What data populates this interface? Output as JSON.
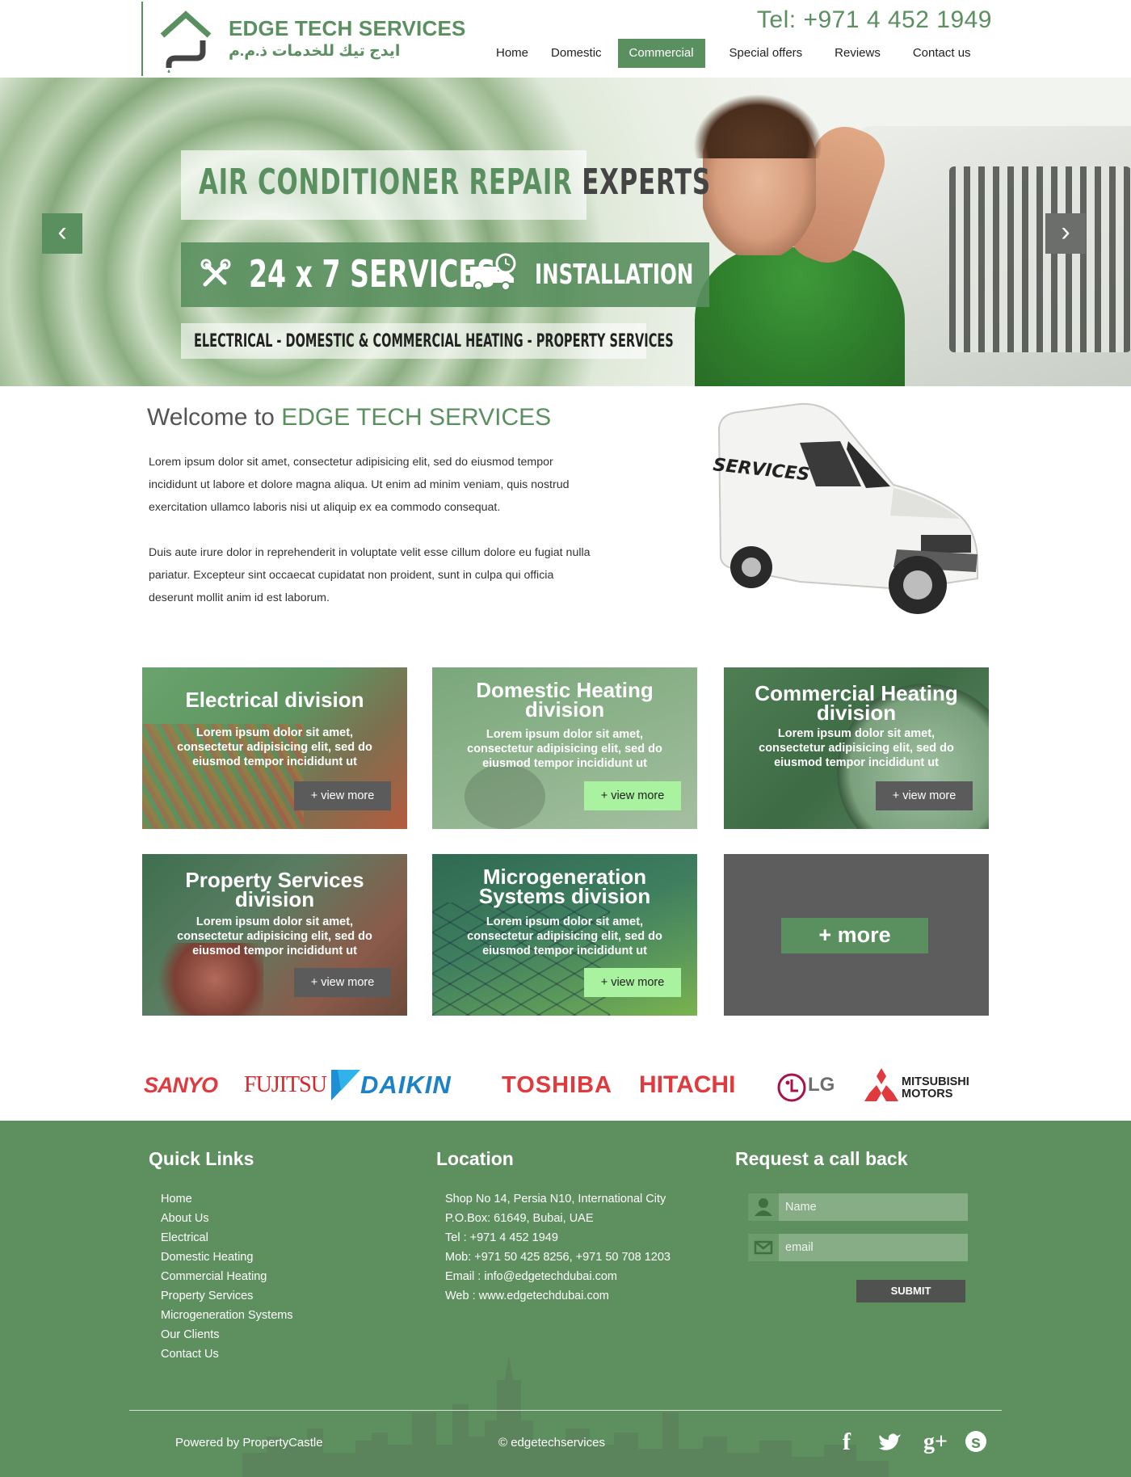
{
  "header": {
    "logo_title": "EDGE TECH SERVICES",
    "logo_arabic": "ايدج تيك للخدمات ذ.م.م",
    "phone": "Tel: +971 4 452 1949",
    "nav": [
      "Home",
      "Domestic",
      "Commercial",
      "Special offers",
      "Reviews",
      "Contact us"
    ],
    "nav_active": "Commercial"
  },
  "hero": {
    "title_green": "AIR  CONDITIONER REPAIR",
    "title_dark": "EXPERTS",
    "services": "24 x 7 SERVICES",
    "installation": "INSTALLATION",
    "subtitle": "ELECTRICAL - DOMESTIC & COMMERCIAL HEATING - PROPERTY SERVICES",
    "prev": "‹",
    "next": "›"
  },
  "welcome": {
    "title_prefix": "Welcome to",
    "title_brand": "EDGE TECH SERVICES",
    "p1_lines": [
      "Lorem ipsum dolor sit amet, consectetur adipisicing elit, sed do eiusmod tempor",
      "incididunt ut labore et dolore magna aliqua. Ut enim ad minim veniam, quis nostrud",
      "exercitation ullamco laboris nisi ut aliquip ex ea commodo consequat."
    ],
    "p2_lines": [
      "Duis aute irure dolor in reprehenderit in voluptate velit esse cillum dolore eu fugiat nulla",
      "pariatur. Excepteur sint occaecat cupidatat non proident, sunt in culpa qui officia",
      "deserunt mollit anim id est laborum."
    ],
    "van_label": "SERVICES"
  },
  "divisions": [
    {
      "title_lines": [
        "Electrical division"
      ],
      "desc_lines": [
        "Lorem ipsum dolor sit amet,",
        "consectetur adipisicing elit, sed do",
        "eiusmod tempor incididunt ut"
      ],
      "button": "+ view more"
    },
    {
      "title_lines": [
        "Domestic Heating",
        "division"
      ],
      "desc_lines": [
        "Lorem ipsum dolor sit amet,",
        "consectetur adipisicing elit, sed do",
        "eiusmod tempor incididunt ut"
      ],
      "button": "+ view more"
    },
    {
      "title_lines": [
        "Commercial Heating",
        "division"
      ],
      "desc_lines": [
        "Lorem ipsum dolor sit amet,",
        "consectetur adipisicing elit, sed do",
        "eiusmod tempor incididunt ut"
      ],
      "button": "+ view more"
    },
    {
      "title_lines": [
        "Property Services",
        "division"
      ],
      "desc_lines": [
        "Lorem ipsum dolor sit amet,",
        "consectetur adipisicing elit, sed do",
        "eiusmod tempor incididunt ut"
      ],
      "button": "+ view more"
    },
    {
      "title_lines": [
        "Microgeneration",
        "Systems division"
      ],
      "desc_lines": [
        "Lorem ipsum dolor sit amet,",
        "consectetur adipisicing elit, sed do",
        "eiusmod tempor incididunt ut"
      ],
      "button": "+ view more"
    }
  ],
  "more_button": "+ more",
  "brands": [
    "SANYO",
    "FUJITSU",
    "DAIKIN",
    "TOSHIBA",
    "HITACHI",
    "LG",
    "MITSUBISHI",
    "MOTORS"
  ],
  "footer": {
    "quick_links_title": "Quick Links",
    "quick_links": [
      "Home",
      "About Us",
      "Electrical",
      "Domestic Heating",
      "Commercial Heating",
      "Property Services",
      "Microgeneration Systems",
      "Our Clients",
      "Contact Us"
    ],
    "location_title": "Location",
    "location_lines": [
      "Shop No 14, Persia N10, International City",
      "P.O.Box: 61649, Bubai, UAE",
      "Tel : +971 4 452 1949",
      "Mob: +971 50 425 8256,    +971 50 708 1203",
      "Email : info@edgetechdubai.com",
      "Web : www.edgetechdubai.com"
    ],
    "callback_title": "Request a call back",
    "name_placeholder": "Name",
    "email_placeholder": "email",
    "submit": "SUBMIT",
    "powered_by": "Powered by PropertyCastle",
    "copyright": "© edgetechservices",
    "social": [
      "f",
      "t",
      "g+",
      "s"
    ]
  },
  "colors": {
    "brand_green": "#5a8f5f",
    "dark_gray": "#5a5b5a",
    "light_green_button": "#a9f2a0"
  }
}
